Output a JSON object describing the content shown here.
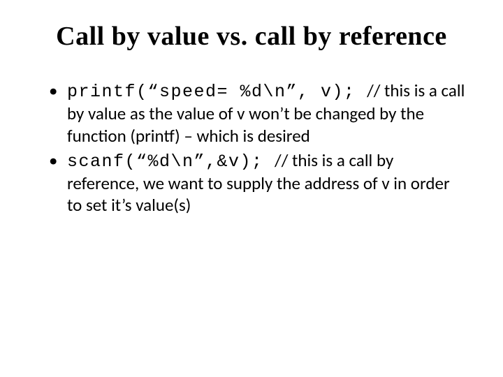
{
  "title": "Call by value vs. call by reference",
  "bullets": [
    {
      "code": "printf(“speed= %d\\n”, v); ",
      "text": "// this is a call by value as the value of v won’t be changed by the function (printf) – which is desired"
    },
    {
      "code": "scanf(“%d\\n”,&v); ",
      "text": "// this is a call by reference, we want to supply the address of v in order to set it’s value(s)"
    }
  ]
}
